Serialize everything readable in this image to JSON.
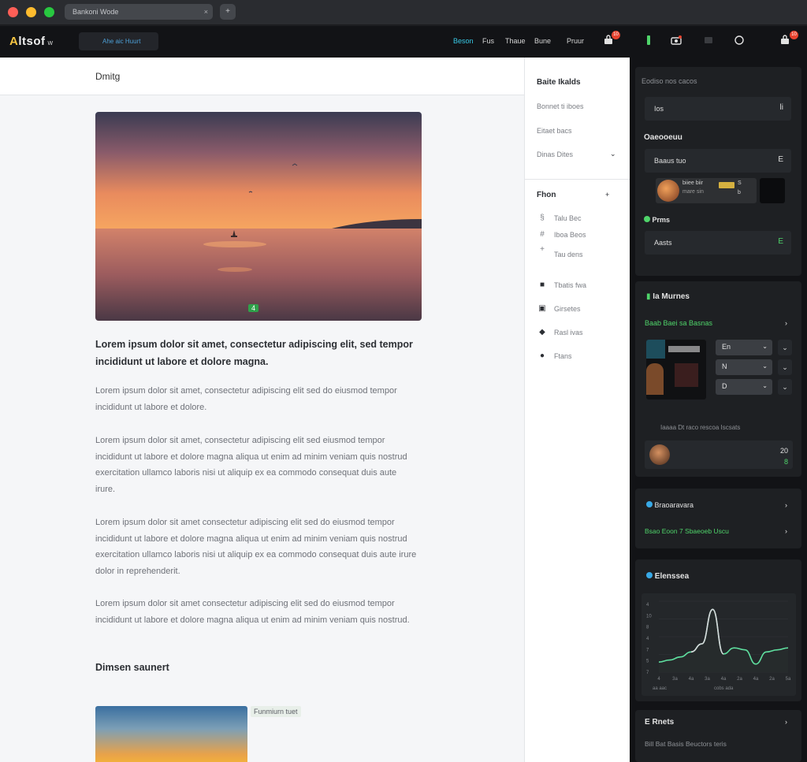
{
  "window": {
    "tab_title": "Bankoni Wode",
    "tab_close": "×",
    "new_tab": "+"
  },
  "appbar": {
    "logo_main": "A",
    "logo_rest": "ltsof",
    "logo_suffix": "w",
    "search_label": "Ahe aic Huurt",
    "nav": [
      "Beson",
      "Fus",
      "Thaue",
      "Bune",
      "Pruur"
    ],
    "badges": [
      "10",
      "10"
    ],
    "icons": [
      "bag-icon",
      "bar-icon",
      "camera-icon",
      "cart-icon",
      "ring-icon",
      "user-icon"
    ]
  },
  "article": {
    "header": "Dmitg",
    "image_marker": "4",
    "lead": "Lorem ipsum dolor sit amet, consectetur adipiscing elit, sed tempor incididunt ut labore et dolore magna.",
    "paragraphs": [
      "Lorem ipsum dolor sit amet, consectetur adipiscing elit sed do eiusmod tempor incididunt ut labore et dolore.",
      "Lorem ipsum dolor sit amet, consectetur adipiscing elit sed eiusmod tempor incididunt ut labore et dolore magna aliqua ut enim ad minim veniam quis nostrud exercitation ullamco laboris nisi ut aliquip ex ea commodo consequat duis aute irure.",
      "Lorem ipsum dolor sit amet consectetur adipiscing elit sed do eiusmod tempor incididunt ut labore et dolore magna aliqua ut enim ad minim veniam quis nostrud exercitation ullamco laboris nisi ut aliquip ex ea commodo consequat duis aute irure dolor in reprehenderit.",
      "Lorem ipsum dolor sit amet consectetur adipiscing elit sed do eiusmod tempor incididunt ut labore et dolore magna aliqua ut enim ad minim veniam quis nostrud."
    ],
    "subheading": "Dimsen saunert",
    "caption": "Funmiurn tuet"
  },
  "side": {
    "section1_title": "Baite Ikalds",
    "section1_items": [
      "Bonnet ti iboes",
      "Eitaet bacs",
      "Dinas Dites"
    ],
    "section1_chevron": "⌄",
    "section2_title": "Fhon",
    "section2_action": "+",
    "section2_items": [
      {
        "icon": "§",
        "label": "Talu Bec"
      },
      {
        "icon": "#",
        "label": "Iboa Beos"
      },
      {
        "icon": "+",
        "label": "Tau dens"
      }
    ],
    "section3_items": [
      {
        "icon": "■",
        "label": "Tbatis fwa"
      },
      {
        "icon": "▣",
        "label": "Girsetes"
      },
      {
        "icon": "◆",
        "label": "Rasl ivas"
      },
      {
        "icon": "●",
        "label": "Ftans"
      }
    ]
  },
  "right": {
    "top_label": "Eodiso nos cacos",
    "field1": {
      "value": "Ios",
      "end": "li"
    },
    "section_label": "Oaeooeuu",
    "field2": {
      "value": "Baaus tuo",
      "end": "E"
    },
    "player_title": "biiee biir",
    "player_sub": "mare sin",
    "player_time": "S",
    "player_bar": "b",
    "status_label": "Prms",
    "field3": {
      "value": "Aasts",
      "end": "E"
    },
    "automations": {
      "title": "Ia Murnes",
      "link": "Baab Baei sa Basnas",
      "chevron": "›",
      "options": [
        "En",
        "N",
        "D"
      ],
      "arrows": [
        "⌄",
        "⌄",
        "⌄"
      ],
      "footer_text": "Iaaaa Dt raco rescoa Iscsats",
      "footer_value": "20",
      "footer_mark": "8"
    },
    "settings": {
      "title": "Braoaravara",
      "chevron": "›",
      "sub": "Bsao Eoon 7 Sbaeoeb Uscu",
      "sub_chevron": "›"
    },
    "chart_card": {
      "title": "Elenssea"
    },
    "tasks": {
      "title": "E Rnets",
      "chevron": "›",
      "sub": "Bill Bat Basis Beuctors teris"
    }
  },
  "chart_data": {
    "type": "area",
    "title": "",
    "xlabel": "",
    "ylabel": "",
    "x": [
      0,
      1,
      2,
      3,
      4,
      5,
      6,
      7,
      8,
      9,
      10,
      11,
      12
    ],
    "series": [
      {
        "values": [
          10,
          12,
          15,
          20,
          28,
          62,
          18,
          24,
          22,
          8,
          20,
          22,
          24
        ]
      }
    ],
    "ylim": [
      0,
      70
    ],
    "colors": {
      "line": "#5fe0a0",
      "peak": "#d8d8dc",
      "fill": "#262b2c"
    },
    "grid": true,
    "x_tick_labels": [
      "4",
      "3a",
      "4a",
      "3a",
      "4a",
      "2a",
      "4a",
      "2a",
      "5a"
    ],
    "y_tick_labels": [
      "4",
      "10",
      "8",
      "4",
      "7",
      "5",
      "7"
    ],
    "footer_left": "aa aac",
    "footer_mid": "cobs ada"
  }
}
